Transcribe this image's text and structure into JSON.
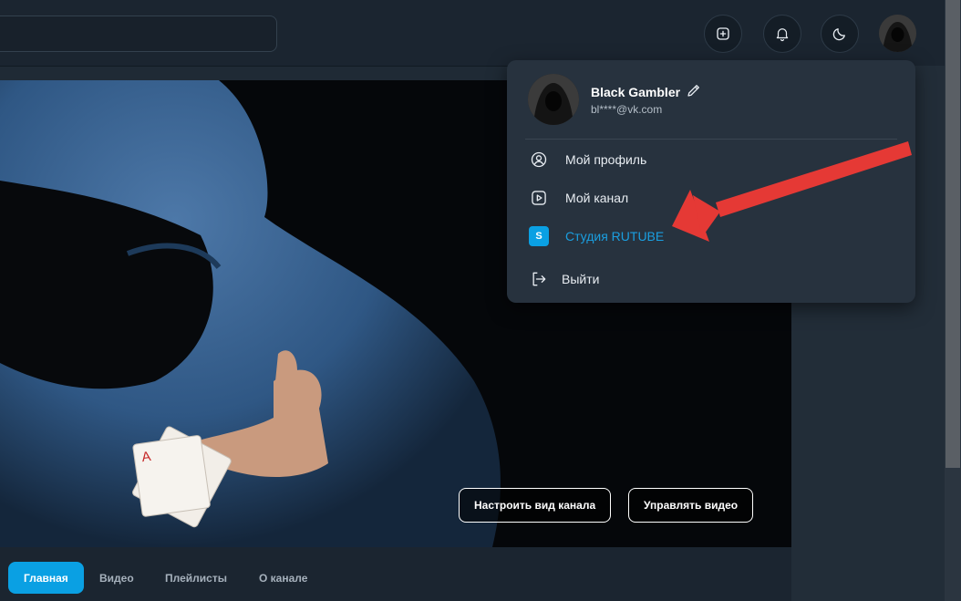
{
  "header": {
    "search_placeholder": "",
    "icons": [
      "plus-square-icon",
      "bell-icon",
      "moon-icon"
    ]
  },
  "banner": {
    "customize_button": "Настроить вид канала",
    "manage_button": "Управлять видео"
  },
  "tabs": [
    {
      "label": "Главная",
      "active": true
    },
    {
      "label": "Видео"
    },
    {
      "label": "Плейлисты"
    },
    {
      "label": "О канале"
    }
  ],
  "dropdown": {
    "user_name": "Black Gambler",
    "email": "bl****@vk.com",
    "items": [
      {
        "label": "Мой профиль",
        "icon": "user-circle-icon"
      },
      {
        "label": "Мой канал",
        "icon": "play-square-icon"
      },
      {
        "label": "Студия RUTUBE",
        "icon": "studio-s-icon",
        "badge": "S"
      },
      {
        "label": "Выйти",
        "icon": "logout-icon"
      }
    ]
  },
  "colors": {
    "accent": "#0aa0e3",
    "annotation_arrow": "#e53935"
  }
}
